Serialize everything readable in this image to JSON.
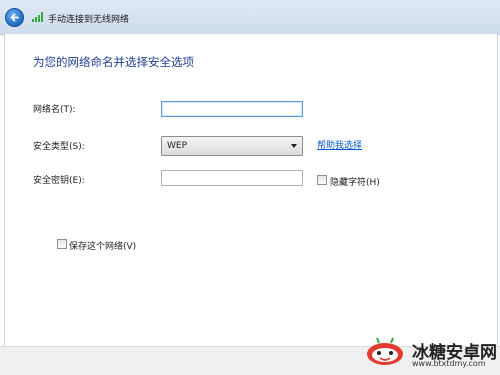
{
  "window": {
    "title": "手动连接到无线网络"
  },
  "form": {
    "heading": "为您的网络命名并选择安全选项",
    "network_name_label": "网络名(T):",
    "network_name_value": "",
    "security_type_label": "安全类型(S):",
    "security_type_value": "WEP",
    "help_link": "帮助我选择",
    "security_key_label": "安全密钥(E):",
    "security_key_value": "",
    "hide_chars_label": "隐藏字符(H)",
    "hide_chars_checked": false,
    "save_network_label": "保存这个网络(V)",
    "save_network_checked": false
  },
  "watermark": {
    "text": "冰糖安卓网",
    "url": "www.btxtdmy.com"
  },
  "colors": {
    "heading": "#1e3f90",
    "link": "#0b5bcc",
    "titlebar": "#dfe9f5"
  }
}
